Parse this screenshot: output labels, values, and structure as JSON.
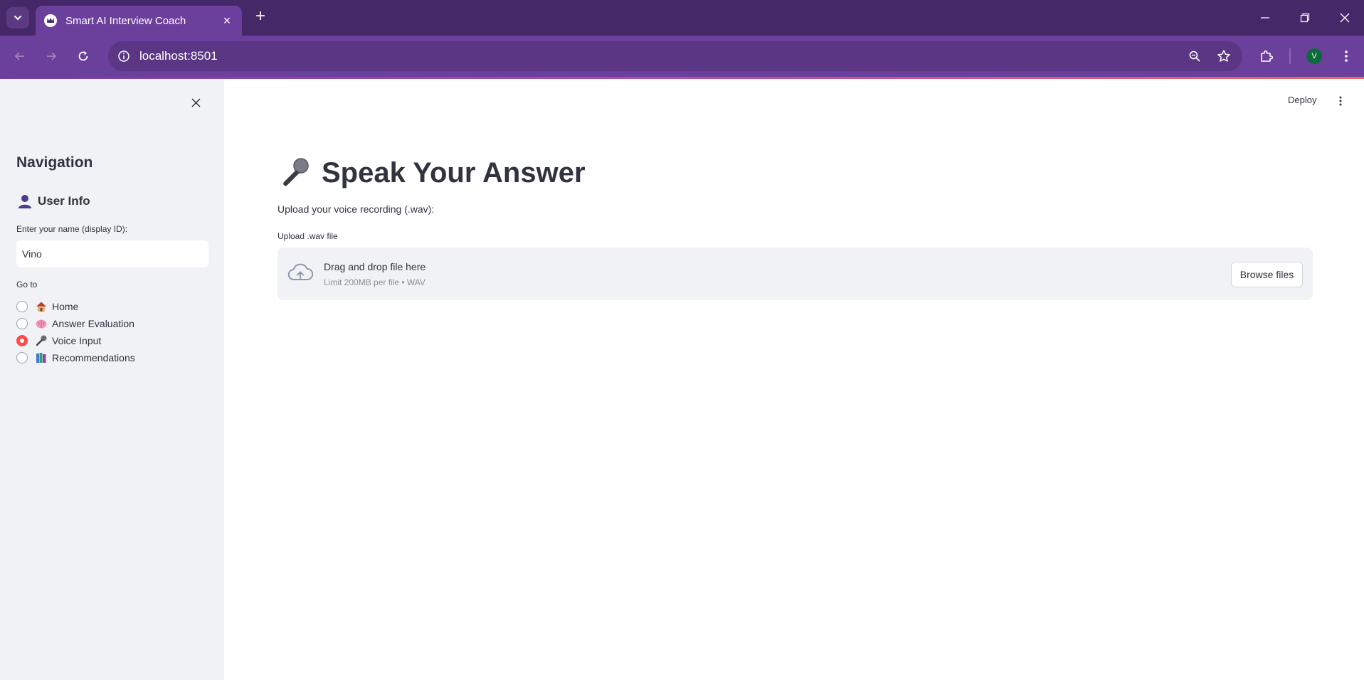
{
  "browser": {
    "tab_title": "Smart AI Interview Coach",
    "tab_close": "×",
    "new_tab": "+",
    "url": "localhost:8501",
    "profile_initial": "V"
  },
  "app": {
    "deploy_label": "Deploy"
  },
  "sidebar": {
    "heading": "Navigation",
    "user_info_heading": "User Info",
    "name_label": "Enter your name (display ID):",
    "name_value": "Vino",
    "goto_label": "Go to",
    "options": [
      {
        "label": "Home",
        "icon": "house-icon",
        "checked": false
      },
      {
        "label": "Answer Evaluation",
        "icon": "brain-icon",
        "checked": false
      },
      {
        "label": "Voice Input",
        "icon": "microphone-icon",
        "checked": true
      },
      {
        "label": "Recommendations",
        "icon": "books-icon",
        "checked": false
      }
    ]
  },
  "main": {
    "title": "Speak Your Answer",
    "prompt": "Upload your voice recording (.wav):",
    "uploader": {
      "label": "Upload .wav file",
      "drop_text": "Drag and drop file here",
      "limit_text": "Limit 200MB per file • WAV",
      "browse_label": "Browse files"
    }
  },
  "colors": {
    "tabbar": "#452867",
    "toolbar": "#6b3f9c",
    "sidebar_bg": "#f0f2f6",
    "accent": "#ff4b4b",
    "text": "#31333f"
  }
}
